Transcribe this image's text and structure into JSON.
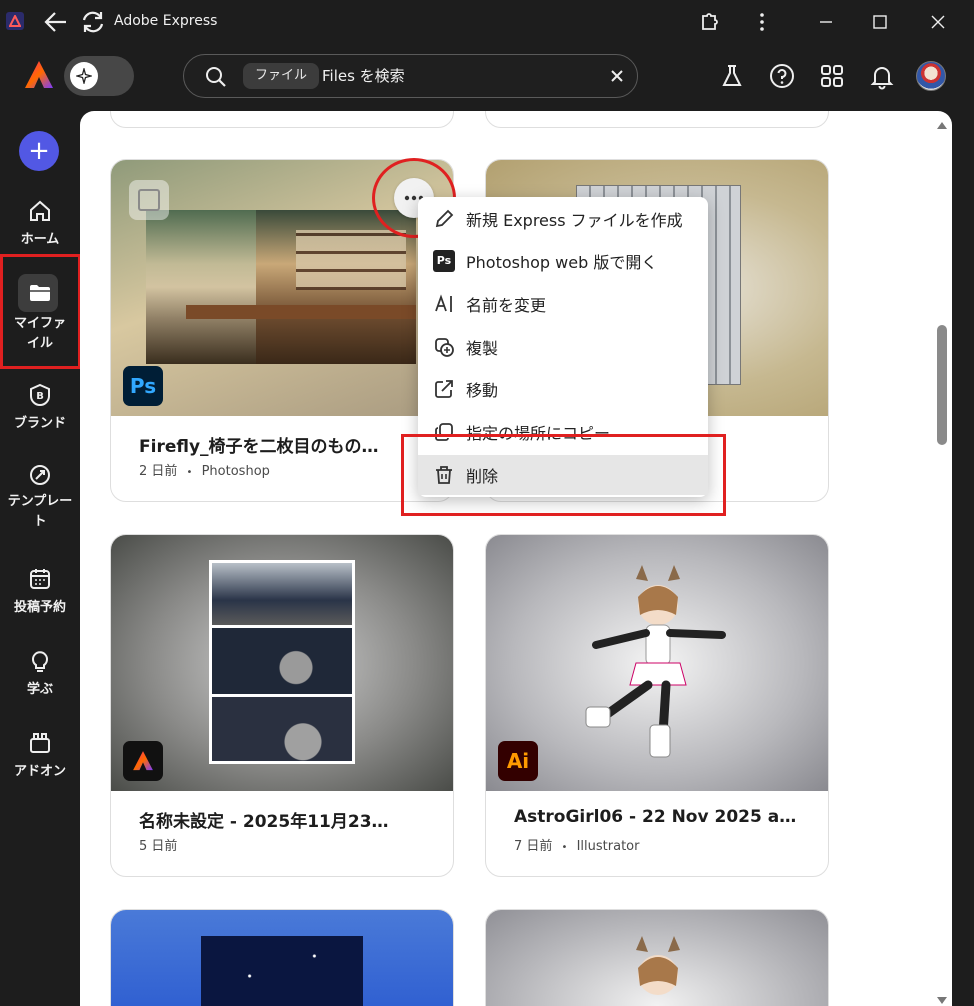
{
  "window": {
    "title": "Adobe Express",
    "back_icon": "arrow-left-icon",
    "refresh_icon": "refresh-icon",
    "extension_icon": "puzzle-icon",
    "more_icon": "vertical-dots-icon"
  },
  "header": {
    "search": {
      "chip": "ファイル",
      "placeholder": "Files を検索"
    },
    "icons": [
      "flask-icon",
      "help-icon",
      "apps-grid-icon",
      "bell-icon",
      "avatar"
    ]
  },
  "sidebar": {
    "create_label": "+",
    "items": [
      {
        "label": "ホーム",
        "icon": "home-icon"
      },
      {
        "label": "マイファイル",
        "icon": "folder-icon",
        "active": true
      },
      {
        "label": "ブランド",
        "icon": "brand-icon"
      },
      {
        "label": "テンプレート",
        "icon": "template-icon"
      },
      {
        "label": "投稿予約",
        "icon": "calendar-icon"
      },
      {
        "label": "学ぶ",
        "icon": "lightbulb-icon"
      },
      {
        "label": "アドオン",
        "icon": "addon-icon"
      }
    ]
  },
  "cards": [
    {
      "title": "Firefly_椅子を二枚目のもの…",
      "age": "2 日前",
      "app": "Photoshop",
      "badge": "Ps"
    },
    {
      "title": "",
      "age": "",
      "app": "",
      "badge": ""
    },
    {
      "title": "名称未設定 - 2025年11月23…",
      "age": "5 日前",
      "app": "",
      "badge": "Express"
    },
    {
      "title": "AstroGirl06 - 22 Nov 2025 a…",
      "age": "7 日前",
      "app": "Illustrator",
      "badge": "Ai"
    }
  ],
  "meta_separator": "•",
  "context_menu": {
    "items": [
      {
        "label": "新規 Express ファイルを作成",
        "icon": "pencil-icon"
      },
      {
        "label": "Photoshop web 版で開く",
        "icon": "photoshop-icon"
      },
      {
        "label": "名前を変更",
        "icon": "rename-icon"
      },
      {
        "label": "複製",
        "icon": "duplicate-icon"
      },
      {
        "label": "移動",
        "icon": "move-icon"
      },
      {
        "label": "指定の場所にコピー",
        "icon": "copy-to-icon"
      },
      {
        "label": "削除",
        "icon": "trash-icon",
        "highlighted": true
      }
    ]
  },
  "colors": {
    "highlight": "#e02020",
    "create_button": "#5258e4"
  }
}
